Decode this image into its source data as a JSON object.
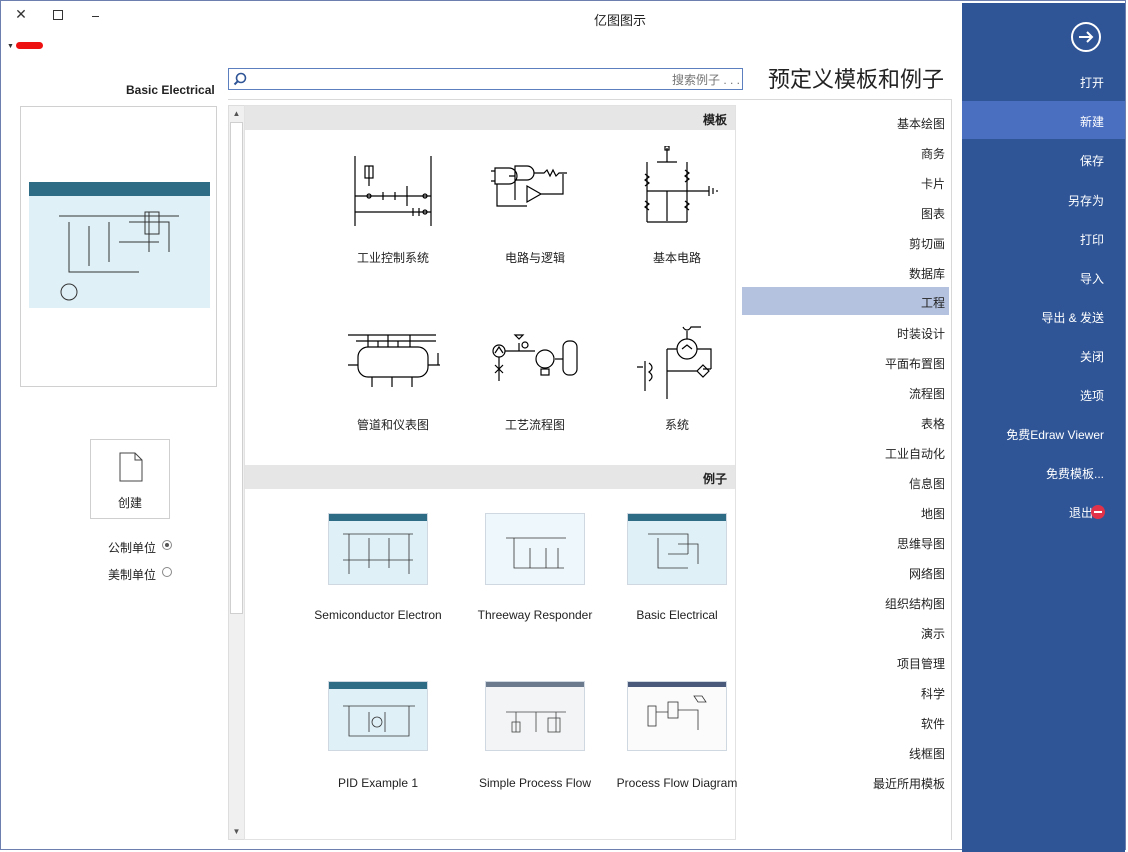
{
  "window": {
    "title": "亿图图示",
    "close_glyph": "✕"
  },
  "nav": {
    "items": [
      {
        "label": "打开"
      },
      {
        "label": "新建"
      },
      {
        "label": "保存"
      },
      {
        "label": "另存为"
      },
      {
        "label": "打印"
      },
      {
        "label": "导入"
      },
      {
        "label": "导出 & 发送"
      },
      {
        "label": "关闭"
      },
      {
        "label": "选项"
      },
      {
        "label": "免费Edraw Viewer"
      },
      {
        "label": "免费模板..."
      },
      {
        "label": "退出"
      }
    ],
    "active": "新建",
    "bg_color": "#2f5597"
  },
  "heading": "预定义模板和例子",
  "search": {
    "placeholder": "搜索例子 . . ."
  },
  "categories": [
    {
      "label": "基本绘图"
    },
    {
      "label": "商务"
    },
    {
      "label": "卡片"
    },
    {
      "label": "图表"
    },
    {
      "label": "剪切画"
    },
    {
      "label": "数据库"
    },
    {
      "label": "工程"
    },
    {
      "label": "时装设计"
    },
    {
      "label": "平面布置图"
    },
    {
      "label": "流程图"
    },
    {
      "label": "表格"
    },
    {
      "label": "工业自动化"
    },
    {
      "label": "信息图"
    },
    {
      "label": "地图"
    },
    {
      "label": "思维导图"
    },
    {
      "label": "网络图"
    },
    {
      "label": "组织结构图"
    },
    {
      "label": "演示"
    },
    {
      "label": "项目管理"
    },
    {
      "label": "科学"
    },
    {
      "label": "软件"
    },
    {
      "label": "线框图"
    },
    {
      "label": "最近所用模板"
    }
  ],
  "active_category": "工程",
  "templates": {
    "header": "模板",
    "items": [
      {
        "label": "基本电路"
      },
      {
        "label": "电路与逻辑"
      },
      {
        "label": "工业控制系统"
      },
      {
        "label": "系统"
      },
      {
        "label": "工艺流程图"
      },
      {
        "label": "管道和仪表图"
      }
    ]
  },
  "examples": {
    "header": "例子",
    "items": [
      {
        "label": "Basic Electrical"
      },
      {
        "label": "Threeway Responder"
      },
      {
        "label": "Semiconductor Electron"
      },
      {
        "label": "Process Flow Diagram"
      },
      {
        "label": "Simple Process Flow"
      },
      {
        "label": "PID Example 1"
      }
    ]
  },
  "preview": {
    "title": "Basic Electrical",
    "create_label": "创建"
  },
  "units": [
    {
      "label": "公制单位",
      "selected": true
    },
    {
      "label": "美制单位",
      "selected": false
    }
  ]
}
